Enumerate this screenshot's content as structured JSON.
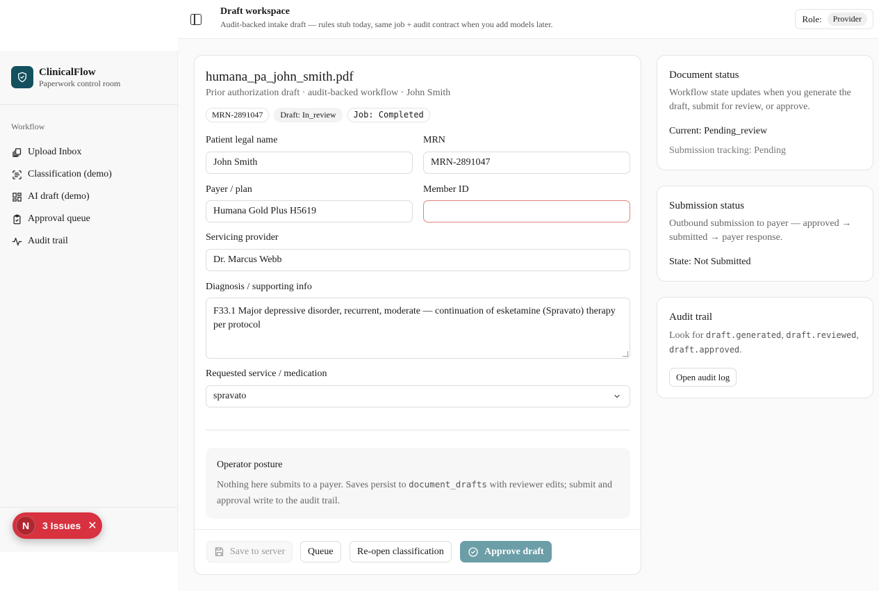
{
  "header": {
    "title": "Draft workspace",
    "subtitle": "Audit-backed intake draft — rules stub today, same job + audit contract when you add models later.",
    "role_label": "Role:",
    "role_value": "Provider"
  },
  "sidebar": {
    "brand_name": "ClinicalFlow",
    "brand_sub": "Paperwork control room",
    "nav_heading": "Workflow",
    "items": [
      {
        "label": "Upload Inbox",
        "icon": "file-stack-icon"
      },
      {
        "label": "Classification (demo)",
        "icon": "scan-text-icon"
      },
      {
        "label": "AI draft (demo)",
        "icon": "layout-grid-icon"
      },
      {
        "label": "Approval queue",
        "icon": "clipboard-check-icon"
      },
      {
        "label": "Audit trail",
        "icon": "activity-icon"
      }
    ]
  },
  "issues_badge": {
    "avatar": "N",
    "label": "3 Issues"
  },
  "document": {
    "filename": "humana_pa_john_smith.pdf",
    "subtitle": "Prior authorization draft · audit-backed workflow · John Smith",
    "badges": {
      "mrn": "MRN-2891047",
      "draft": "Draft: In_review",
      "job": "Job: Completed"
    }
  },
  "form": {
    "patient_name": {
      "label": "Patient legal name",
      "value": "John Smith"
    },
    "mrn": {
      "label": "MRN",
      "value": "MRN-2891047"
    },
    "payer": {
      "label": "Payer / plan",
      "value": "Humana Gold Plus H5619"
    },
    "member_id": {
      "label": "Member ID",
      "value": ""
    },
    "provider": {
      "label": "Servicing provider",
      "value": "Dr. Marcus Webb"
    },
    "diagnosis": {
      "label": "Diagnosis / supporting info",
      "value": "F33.1 Major depressive disorder, recurrent, moderate — continuation of esketamine (Spravato) therapy per protocol"
    },
    "service": {
      "label": "Requested service / medication",
      "value": "spravato"
    }
  },
  "posture": {
    "title": "Operator posture",
    "text_1": "Nothing here submits to a payer. Saves persist to ",
    "code": "document_drafts",
    "text_2": " with reviewer edits; submit and approval write to the audit trail."
  },
  "actions": {
    "save": "Save to server",
    "queue": "Queue",
    "reopen": "Re-open classification",
    "approve": "Approve draft"
  },
  "document_status": {
    "title": "Document status",
    "body": "Workflow state updates when you generate the draft, submit for review, or approve.",
    "current": "Current: Pending_review",
    "tracking": "Submission tracking: Pending"
  },
  "submission_status": {
    "title": "Submission status",
    "body": "Outbound submission to payer — approved → submitted → payer response.",
    "state": "State: Not Submitted"
  },
  "audit_card": {
    "title": "Audit trail",
    "look_for": "Look for ",
    "ev1": "draft.generated",
    "sep1": ", ",
    "ev2": "draft.reviewed",
    "sep2": ",",
    "ev3": "draft.approved",
    "end": ".",
    "button": "Open audit log"
  },
  "colors": {
    "brand": "#14505e",
    "primary_button": "#6c9ea8",
    "error_border": "#e38080",
    "issues_badge": "#d8313f"
  }
}
